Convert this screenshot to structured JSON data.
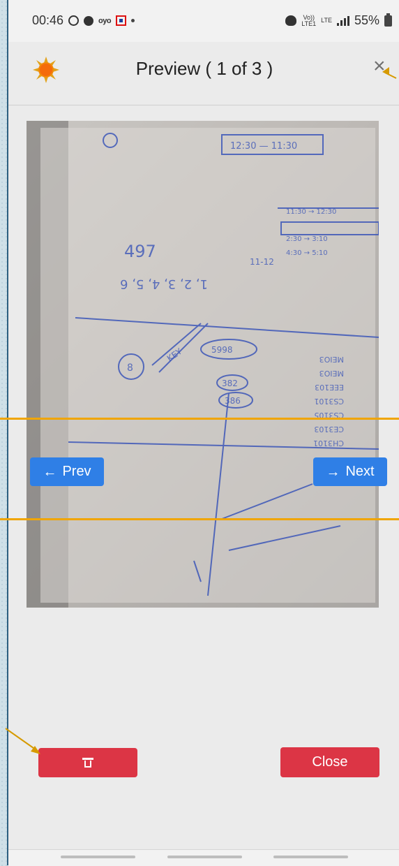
{
  "status_bar": {
    "time": "00:46",
    "oyo": "oyo",
    "volte_top": "Vo))",
    "volte_bottom": "LTE1",
    "lte": "LTE",
    "battery": "55%"
  },
  "header": {
    "title": "Preview ( 1 of 3 )",
    "close_icon": "×"
  },
  "photo": {
    "icon": "photo-of-handwritten-notes",
    "note_box": "12:30 — 11:30",
    "note_number": "497",
    "note_sequence": "1, 2, 3, 4, 5, 6",
    "note_time_a": "11:30 → 12:30",
    "note_time_b": "2:30 → 3:10",
    "note_time_c": "4:30 → 5:10",
    "note_fraction": "11-12",
    "note_circle_a": "5998",
    "note_circle_b": "382",
    "note_circle_c": "386",
    "note_key": "KEY",
    "note_eight": "8",
    "note_codes": [
      "MEIO3",
      "MEIO3",
      "EEE103",
      "CS3101",
      "CS3105",
      "CE3103",
      "CH3101"
    ]
  },
  "navigation": {
    "prev_label": "Prev",
    "next_label": "Next"
  },
  "actions": {
    "delete_icon": "trash-icon",
    "close_label": "Close"
  },
  "colors": {
    "primary": "#2f7fe6",
    "danger": "#dc3545",
    "annotation": "#f0a500"
  }
}
